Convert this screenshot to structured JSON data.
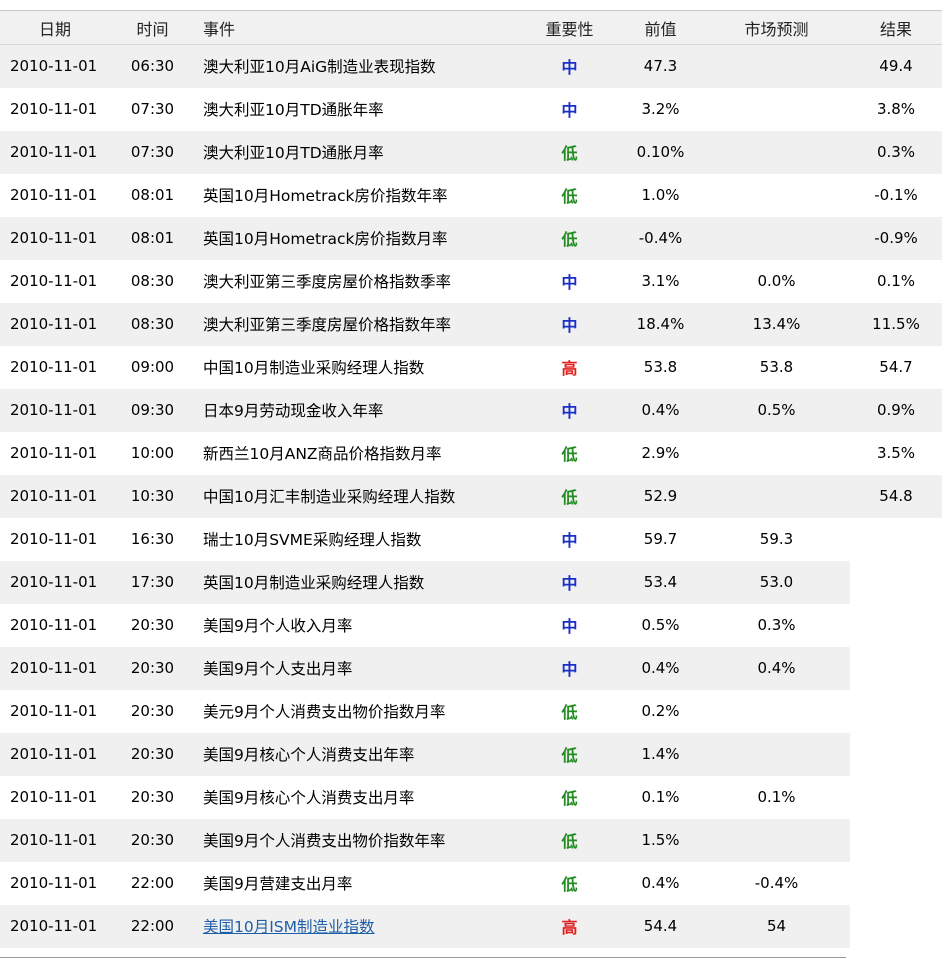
{
  "header": {
    "columns": {
      "date": "日期",
      "time": "时间",
      "event": "事件",
      "importance": "重要性",
      "previous": "前值",
      "forecast": "市场预测",
      "actual": "结果"
    }
  },
  "colors": {
    "importance_mid": "#1a2fc8",
    "importance_low": "#228b22",
    "importance_high": "#e02020",
    "row_alt_background": "#f0f0f0",
    "link": "#1f5fa8"
  },
  "rows": [
    {
      "date": "2010-11-01",
      "time": "06:30",
      "event": "澳大利亚10月AiG制造业表现指数",
      "importance": "中",
      "importance_level": "mid",
      "previous": "47.3",
      "forecast": "",
      "actual": "49.4"
    },
    {
      "date": "2010-11-01",
      "time": "07:30",
      "event": "澳大利亚10月TD通胀年率",
      "importance": "中",
      "importance_level": "mid",
      "previous": "3.2%",
      "forecast": "",
      "actual": "3.8%"
    },
    {
      "date": "2010-11-01",
      "time": "07:30",
      "event": "澳大利亚10月TD通胀月率",
      "importance": "低",
      "importance_level": "low",
      "previous": "0.10%",
      "forecast": "",
      "actual": "0.3%"
    },
    {
      "date": "2010-11-01",
      "time": "08:01",
      "event": "英国10月Hometrack房价指数年率",
      "importance": "低",
      "importance_level": "low",
      "previous": "1.0%",
      "forecast": "",
      "actual": "-0.1%"
    },
    {
      "date": "2010-11-01",
      "time": "08:01",
      "event": "英国10月Hometrack房价指数月率",
      "importance": "低",
      "importance_level": "low",
      "previous": "-0.4%",
      "forecast": "",
      "actual": "-0.9%"
    },
    {
      "date": "2010-11-01",
      "time": "08:30",
      "event": "澳大利亚第三季度房屋价格指数季率",
      "importance": "中",
      "importance_level": "mid",
      "previous": "3.1%",
      "forecast": "0.0%",
      "actual": "0.1%"
    },
    {
      "date": "2010-11-01",
      "time": "08:30",
      "event": "澳大利亚第三季度房屋价格指数年率",
      "importance": "中",
      "importance_level": "mid",
      "previous": "18.4%",
      "forecast": "13.4%",
      "actual": "11.5%"
    },
    {
      "date": "2010-11-01",
      "time": "09:00",
      "event": "中国10月制造业采购经理人指数",
      "importance": "高",
      "importance_level": "high",
      "previous": "53.8",
      "forecast": "53.8",
      "actual": "54.7"
    },
    {
      "date": "2010-11-01",
      "time": "09:30",
      "event": "日本9月劳动现金收入年率",
      "importance": "中",
      "importance_level": "mid",
      "previous": "0.4%",
      "forecast": "0.5%",
      "actual": "0.9%"
    },
    {
      "date": "2010-11-01",
      "time": "10:00",
      "event": "新西兰10月ANZ商品价格指数月率",
      "importance": "低",
      "importance_level": "low",
      "previous": "2.9%",
      "forecast": "",
      "actual": "3.5%"
    },
    {
      "date": "2010-11-01",
      "time": "10:30",
      "event": "中国10月汇丰制造业采购经理人指数",
      "importance": "低",
      "importance_level": "low",
      "previous": "52.9",
      "forecast": "",
      "actual": "54.8"
    },
    {
      "date": "2010-11-01",
      "time": "16:30",
      "event": "瑞士10月SVME采购经理人指数",
      "importance": "中",
      "importance_level": "mid",
      "previous": "59.7",
      "forecast": "59.3",
      "actual": ""
    },
    {
      "date": "2010-11-01",
      "time": "17:30",
      "event": "英国10月制造业采购经理人指数",
      "importance": "中",
      "importance_level": "mid",
      "previous": "53.4",
      "forecast": "53.0",
      "actual": ""
    },
    {
      "date": "2010-11-01",
      "time": "20:30",
      "event": "美国9月个人收入月率",
      "importance": "中",
      "importance_level": "mid",
      "previous": "0.5%",
      "forecast": "0.3%",
      "actual": ""
    },
    {
      "date": "2010-11-01",
      "time": "20:30",
      "event": "美国9月个人支出月率",
      "importance": "中",
      "importance_level": "mid",
      "previous": "0.4%",
      "forecast": "0.4%",
      "actual": ""
    },
    {
      "date": "2010-11-01",
      "time": "20:30",
      "event": "美元9月个人消费支出物价指数月率",
      "importance": "低",
      "importance_level": "low",
      "previous": "0.2%",
      "forecast": "",
      "actual": ""
    },
    {
      "date": "2010-11-01",
      "time": "20:30",
      "event": "美国9月核心个人消费支出年率",
      "importance": "低",
      "importance_level": "low",
      "previous": "1.4%",
      "forecast": "",
      "actual": ""
    },
    {
      "date": "2010-11-01",
      "time": "20:30",
      "event": "美国9月核心个人消费支出月率",
      "importance": "低",
      "importance_level": "low",
      "previous": "0.1%",
      "forecast": "0.1%",
      "actual": ""
    },
    {
      "date": "2010-11-01",
      "time": "20:30",
      "event": "美国9月个人消费支出物价指数年率",
      "importance": "低",
      "importance_level": "low",
      "previous": "1.5%",
      "forecast": "",
      "actual": ""
    },
    {
      "date": "2010-11-01",
      "time": "22:00",
      "event": "美国9月营建支出月率",
      "importance": "低",
      "importance_level": "low",
      "previous": "0.4%",
      "forecast": "-0.4%",
      "actual": ""
    },
    {
      "date": "2010-11-01",
      "time": "22:00",
      "event": "美国10月ISM制造业指数",
      "importance": "高",
      "importance_level": "high",
      "previous": "54.4",
      "forecast": "54",
      "actual": "",
      "is_link": true
    }
  ]
}
